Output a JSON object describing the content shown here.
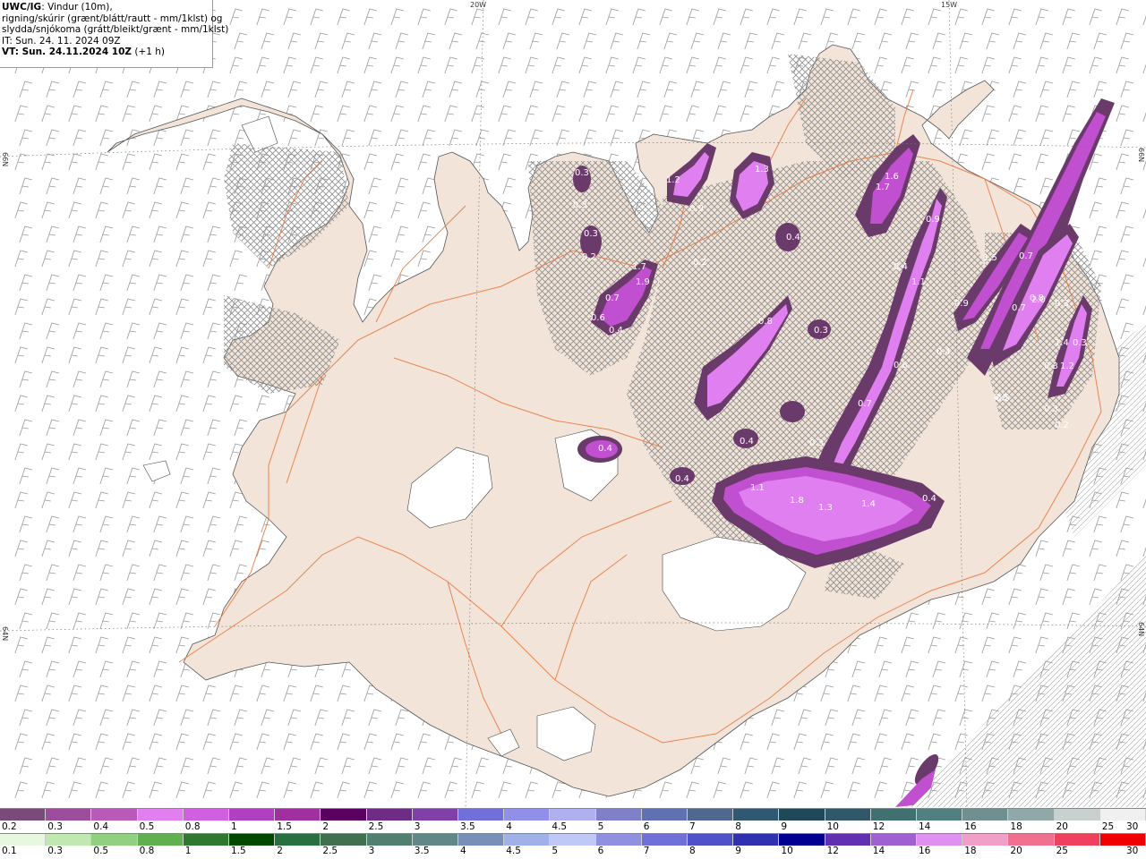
{
  "info": {
    "product": "UWC/IG",
    "line1_rest": ": Vindur (10m),",
    "line2": "rigning/skúrir (grænt/blátt/rautt - mm/1klst) og",
    "line3": "slydda/snjókoma (grátt/bleikt/grænt - mm/1klst)",
    "it": "IT: Sun. 24. 11. 2024 09Z",
    "vt_label": "VT: Sun. 24.11.2024 10Z",
    "vt_suffix": " (+1 h)"
  },
  "grid_labels": {
    "top": [
      "20W",
      "15W"
    ],
    "left": [
      "66N",
      "64N"
    ],
    "right": [
      "66N",
      "64N"
    ]
  },
  "precip_labels": [
    "0.3",
    "0.3",
    "0.3",
    "0.2",
    "1.2",
    "0.9",
    "1.3",
    "1.6",
    "1.7",
    "0.9",
    "0.4",
    "0.2",
    "1.7",
    "1.9",
    "0.7",
    "0.6",
    "0.4",
    "0.4",
    "1.1",
    "0.8",
    "1.5",
    "0.9",
    "0.7",
    "0.3",
    "0.7",
    "0.3",
    "0.3",
    "0.3",
    "0.4",
    "0.6",
    "0.5",
    "0.7",
    "0.8",
    "2.0",
    "1.4",
    "1.2",
    "0.3",
    "0.2",
    "0.5",
    "0.4",
    "0.4",
    "0.4",
    "1.1",
    "1.8",
    "1.3",
    "1.4",
    "0.4",
    "0.3"
  ],
  "colorbar_snow": {
    "colors": [
      "#7a4a7a",
      "#9c4d9c",
      "#b85ab8",
      "#e080f0",
      "#d060e0",
      "#b040c0",
      "#a030a0",
      "#5a0060",
      "#6e2c86",
      "#8040a8",
      "#7070d8",
      "#9090e8",
      "#b0b0f0",
      "#8080c8",
      "#6070b0",
      "#506890",
      "#305870",
      "#204858",
      "#305868",
      "#407070",
      "#508080",
      "#709090",
      "#90a8a8",
      "#c8d0d0",
      "#f0f0f0"
    ],
    "labels": [
      "0.2",
      "0.3",
      "0.4",
      "0.5",
      "0.8",
      "1",
      "1.5",
      "2",
      "2.5",
      "3",
      "3.5",
      "4",
      "4.5",
      "5",
      "6",
      "7",
      "8",
      "9",
      "10",
      "12",
      "14",
      "16",
      "18",
      "20",
      "25",
      "30"
    ]
  },
  "colorbar_rain": {
    "colors": [
      "#e8f8e0",
      "#c0e8b0",
      "#90d080",
      "#60b050",
      "#307830",
      "#004800",
      "#287040",
      "#407050",
      "#508070",
      "#608888",
      "#7890b8",
      "#a0b0e8",
      "#c0c8f8",
      "#9090e0",
      "#7070d8",
      "#5050c8",
      "#3030b0",
      "#000090",
      "#6030b0",
      "#a060d0",
      "#e090f0",
      "#f0a0c8",
      "#f07090",
      "#f04060",
      "#f00000"
    ],
    "labels": [
      "0.1",
      "0.3",
      "0.5",
      "0.8",
      "1",
      "1.5",
      "2",
      "2.5",
      "3",
      "3.5",
      "4",
      "4.5",
      "5",
      "6",
      "7",
      "8",
      "9",
      "10",
      "12",
      "14",
      "16",
      "18",
      "20",
      "25",
      "30"
    ]
  },
  "colors": {
    "land": "#f2e4d8",
    "road": "#e8743a",
    "snow_light": "#e080f0",
    "snow_mid": "#c050d0",
    "snow_dark": "#6a3a6a",
    "ice": "#ffffff",
    "wind_barb": "#999999",
    "hatch": "#8c8c8c"
  }
}
